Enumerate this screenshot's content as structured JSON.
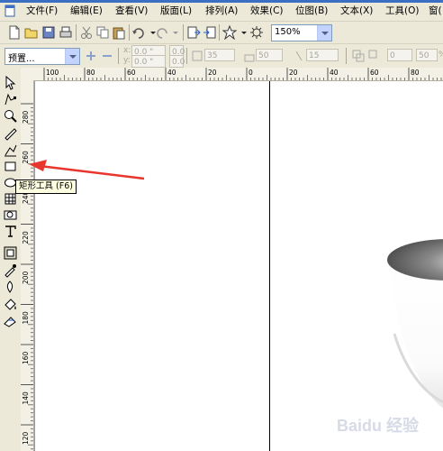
{
  "menu": {
    "items": [
      {
        "label": "文件(F)",
        "name": "menu-file"
      },
      {
        "label": "编辑(E)",
        "name": "menu-edit"
      },
      {
        "label": "查看(V)",
        "name": "menu-view"
      },
      {
        "label": "版面(L)",
        "name": "menu-layout"
      },
      {
        "label": "排列(A)",
        "name": "menu-arrange"
      },
      {
        "label": "效果(C)",
        "name": "menu-effects"
      },
      {
        "label": "位图(B)",
        "name": "menu-bitmaps"
      },
      {
        "label": "文本(X)",
        "name": "menu-text"
      },
      {
        "label": "工具(O)",
        "name": "menu-tools"
      },
      {
        "label": "窗(",
        "name": "menu-window"
      }
    ]
  },
  "toolbar": {
    "zoom_value": "150%"
  },
  "property_bar": {
    "preset_label": "预置...",
    "x_value": "0.0 \"",
    "y_value": "0.0 \"",
    "w_value": "0.0 \"",
    "h_value": "0.0 \"",
    "x_label": "x:",
    "y_label": "y:",
    "scale_a": "35",
    "scale_b": "50",
    "scale_c": "15",
    "angle_a": "0",
    "angle_b": "50",
    "percent": "%"
  },
  "hruler": {
    "ticks": [
      {
        "label": "100"
      },
      {
        "label": "80"
      },
      {
        "label": "60"
      },
      {
        "label": "40"
      },
      {
        "label": "20"
      },
      {
        "label": "0"
      },
      {
        "label": "20"
      },
      {
        "label": "40"
      },
      {
        "label": "60"
      },
      {
        "label": "80"
      }
    ]
  },
  "vruler": {
    "ticks": [
      {
        "label": "280"
      },
      {
        "label": "260"
      },
      {
        "label": "240"
      },
      {
        "label": "220"
      },
      {
        "label": "200"
      },
      {
        "label": "180"
      },
      {
        "label": "160"
      },
      {
        "label": "140"
      },
      {
        "label": "120"
      }
    ]
  },
  "tooltip": {
    "text": "矩形工具 (F6)"
  },
  "annotation": {
    "arrow_color": "#e8362f"
  },
  "watermark": {
    "text": "Baidu 经验"
  }
}
